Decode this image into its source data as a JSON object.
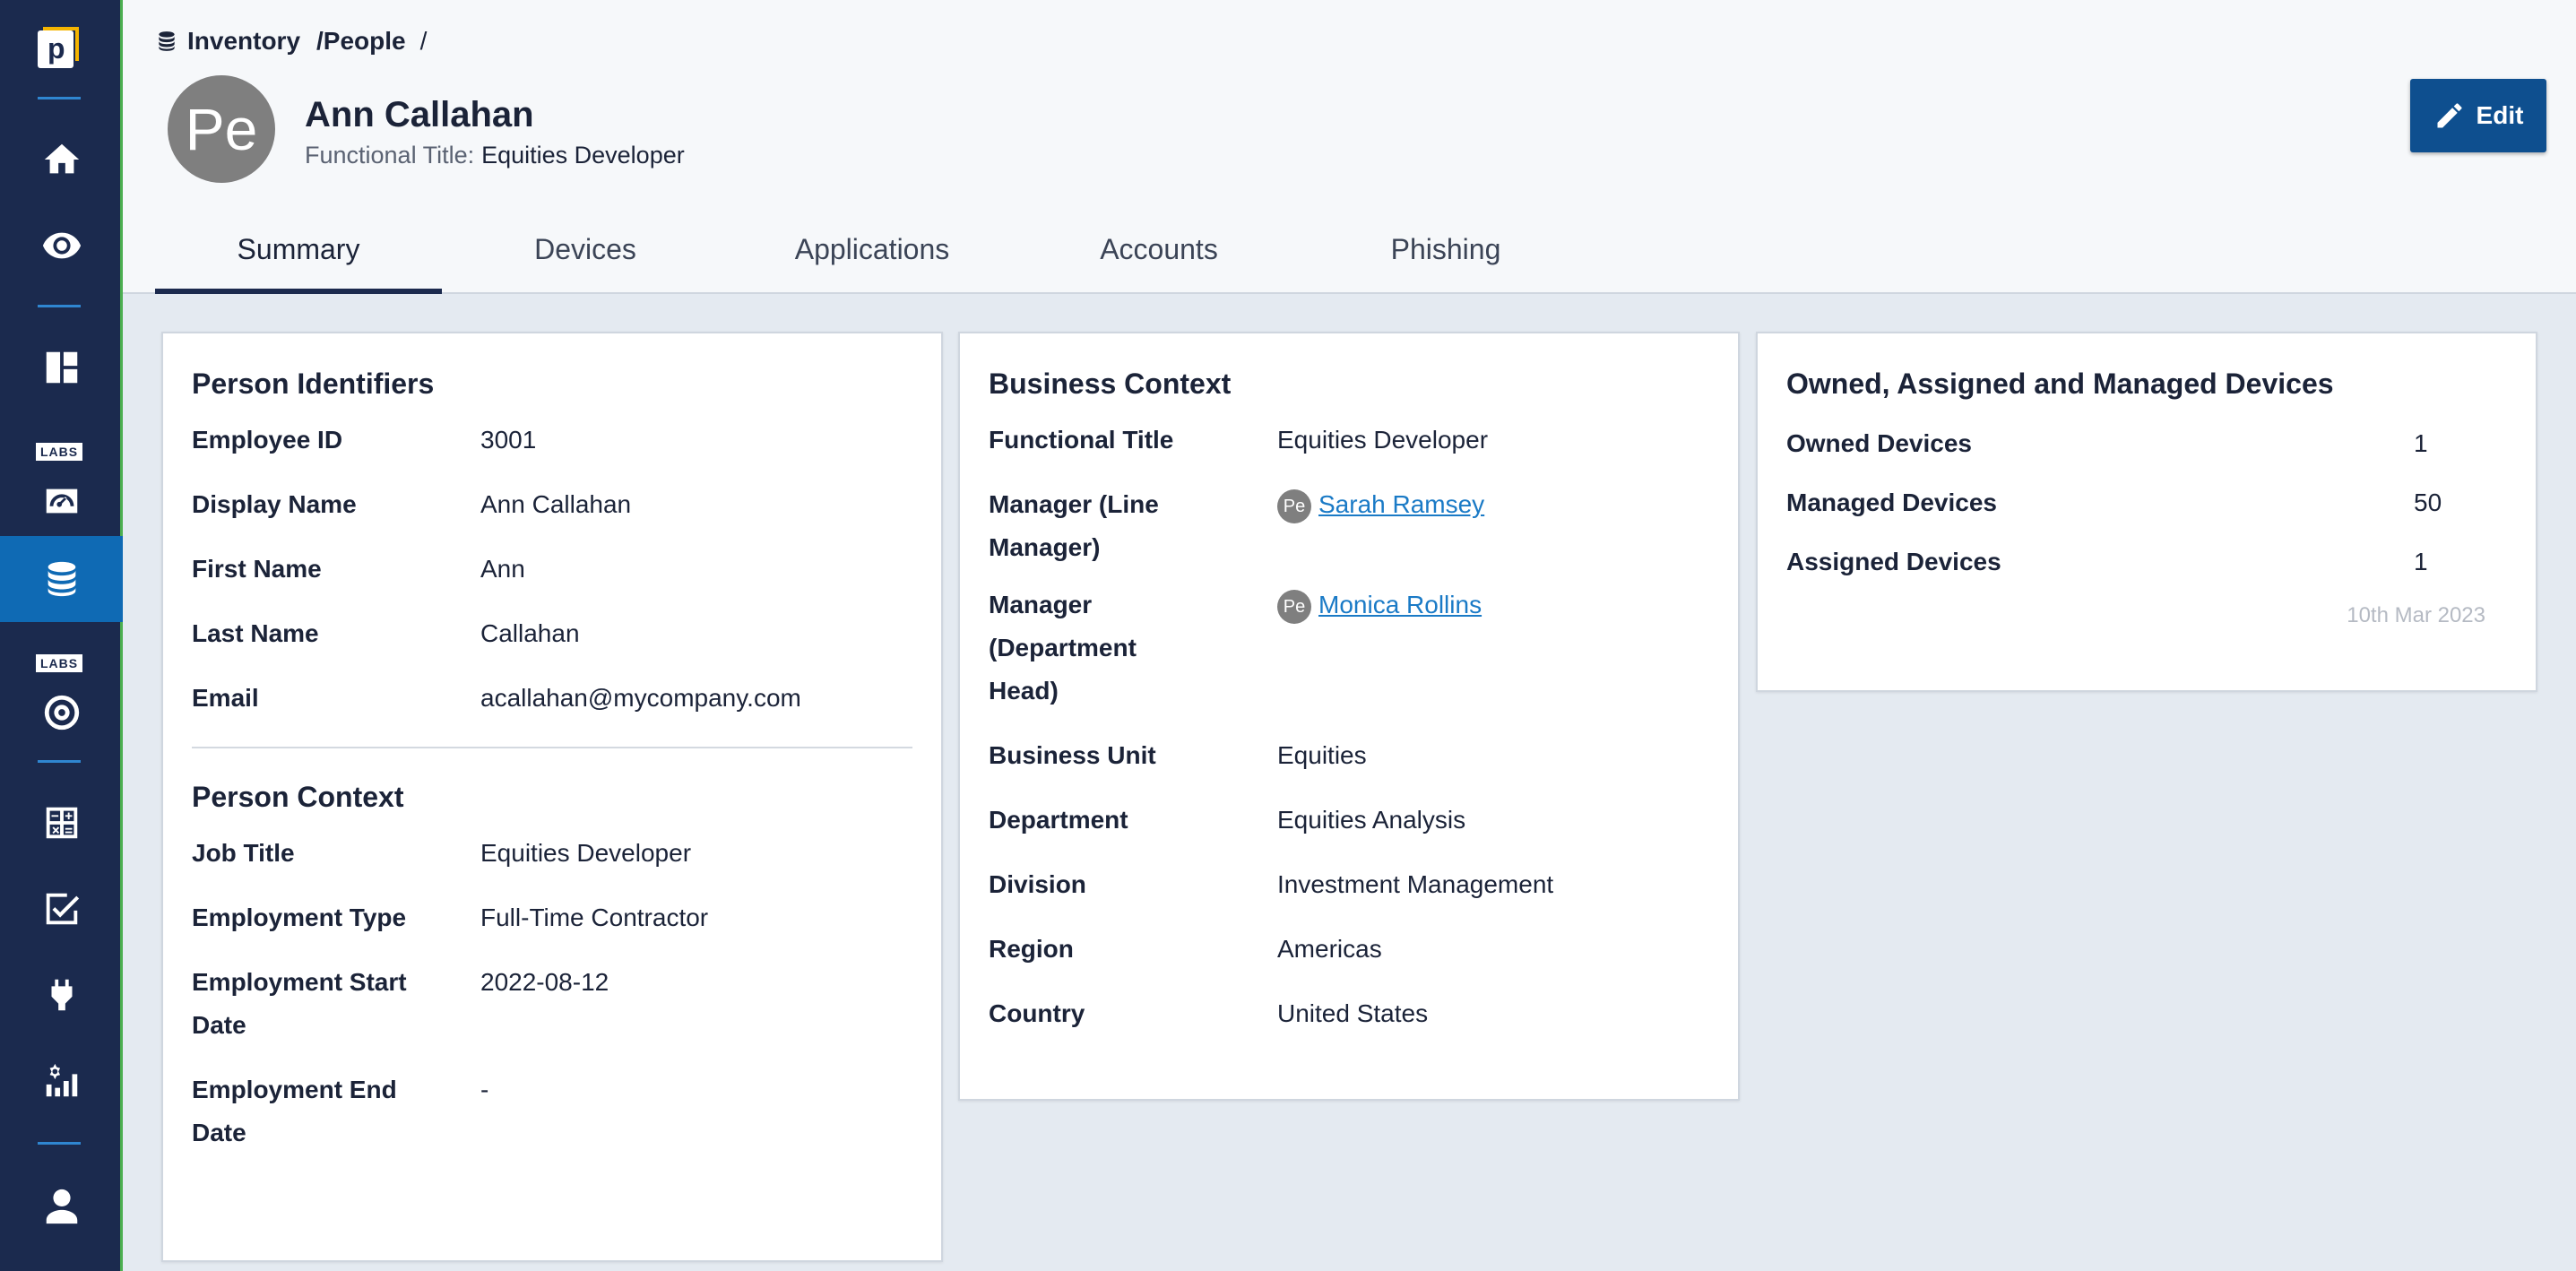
{
  "breadcrumb": {
    "root": "Inventory",
    "section": "/People",
    "trailing": "/"
  },
  "person": {
    "initials": "Pe",
    "name": "Ann Callahan",
    "functional_title_label": "Functional Title:",
    "functional_title_value": "Equities Developer"
  },
  "toolbar": {
    "edit_label": "Edit"
  },
  "tabs": [
    {
      "label": "Summary",
      "active": true
    },
    {
      "label": "Devices"
    },
    {
      "label": "Applications"
    },
    {
      "label": "Accounts"
    },
    {
      "label": "Phishing"
    }
  ],
  "sidebar": {
    "labs_badge": "LABS"
  },
  "person_identifiers": {
    "title": "Person Identifiers",
    "rows": [
      {
        "label": "Employee ID",
        "value": "3001"
      },
      {
        "label": "Display Name",
        "value": "Ann Callahan"
      },
      {
        "label": "First Name",
        "value": "Ann"
      },
      {
        "label": "Last Name",
        "value": "Callahan"
      },
      {
        "label": "Email",
        "value": "acallahan@mycompany.com"
      }
    ]
  },
  "person_context": {
    "title": "Person Context",
    "rows": [
      {
        "label": "Job Title",
        "value": "Equities Developer"
      },
      {
        "label": "Employment Type",
        "value": "Full-Time Contractor"
      },
      {
        "label": "Employment Start Date",
        "value": "2022-08-12"
      },
      {
        "label": "Employment End Date",
        "value": "-"
      }
    ]
  },
  "business_context": {
    "title": "Business Context",
    "rows": [
      {
        "label": "Functional Title",
        "value": "Equities Developer"
      },
      {
        "label": "Manager (Line Manager)",
        "value": "Sarah Ramsey",
        "avatar": "Pe"
      },
      {
        "label": "Manager (Department Head)",
        "value": "Monica Rollins",
        "avatar": "Pe"
      },
      {
        "label": "Business Unit",
        "value": "Equities"
      },
      {
        "label": "Department",
        "value": "Equities Analysis"
      },
      {
        "label": "Division",
        "value": "Investment Management"
      },
      {
        "label": "Region",
        "value": "Americas"
      },
      {
        "label": "Country",
        "value": "United States"
      }
    ]
  },
  "devices": {
    "title": "Owned, Assigned and Managed Devices",
    "rows": [
      {
        "label": "Owned Devices",
        "value": "1"
      },
      {
        "label": "Managed Devices",
        "value": "50"
      },
      {
        "label": "Assigned Devices",
        "value": "1"
      }
    ],
    "updated": "10th Mar 2023"
  }
}
